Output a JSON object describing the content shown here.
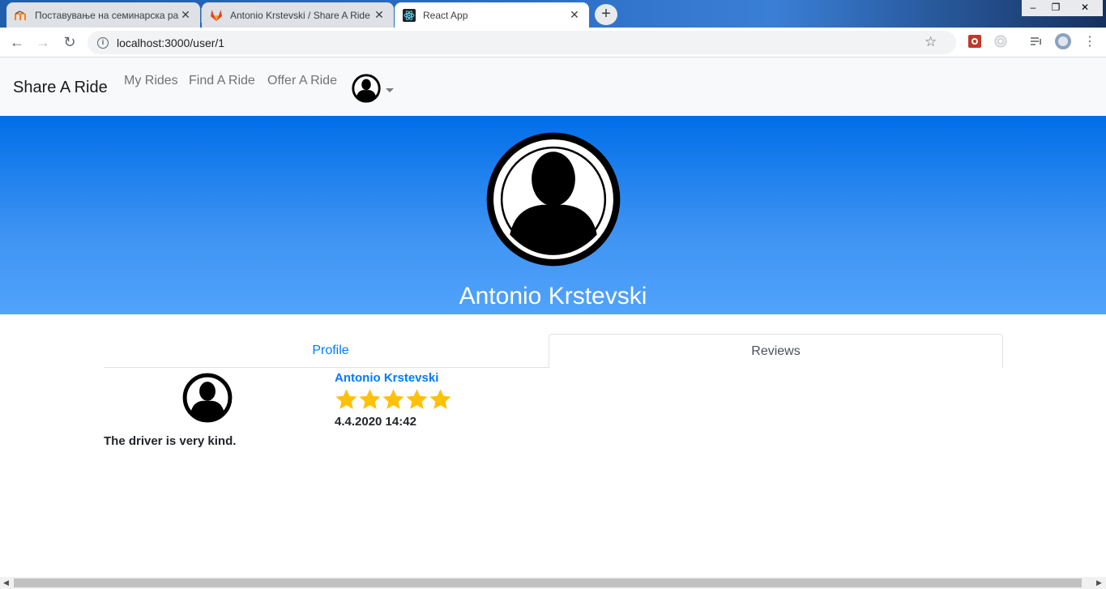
{
  "browser": {
    "tabs": [
      {
        "title": "Поставување на семинарска ра",
        "icon": "moodle-icon",
        "active": false
      },
      {
        "title": "Antonio Krstevski / Share A Ride",
        "icon": "gitlab-icon",
        "active": false
      },
      {
        "title": "React App",
        "icon": "react-icon",
        "active": true
      }
    ],
    "new_tab_label": "+",
    "close_label": "✕",
    "url": "localhost:3000/user/1",
    "window_controls": {
      "minimize": "‒",
      "maximize": "❐",
      "close": "✕"
    }
  },
  "navbar": {
    "brand": "Share A Ride",
    "links": [
      "My Rides",
      "Find A Ride",
      "Offer A Ride"
    ],
    "user_icon": "user-circle-icon"
  },
  "profile": {
    "name": "Antonio Krstevski",
    "avatar_icon": "user-circle-icon"
  },
  "tabs": {
    "profile": "Profile",
    "reviews": "Reviews",
    "active": "Reviews"
  },
  "reviews": [
    {
      "author": "Antonio Krstevski",
      "rating": 5,
      "max_rating": 5,
      "date": "4.4.2020 14:42",
      "text": "The driver is very kind."
    }
  ],
  "colors": {
    "hero_top": "#006ee8",
    "hero_bottom": "#51a3fb",
    "link": "#007bff",
    "star": "#ffc107"
  }
}
